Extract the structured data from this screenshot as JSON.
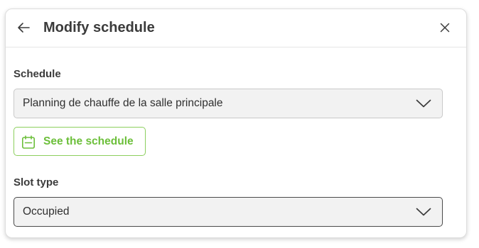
{
  "dialog": {
    "title": "Modify schedule"
  },
  "schedule": {
    "label": "Schedule",
    "selected": "Planning de chauffe de la salle principale"
  },
  "see_schedule": {
    "label": "See the schedule"
  },
  "slot_type": {
    "label": "Slot type",
    "selected": "Occupied"
  },
  "colors": {
    "accent_green": "#6cbf3a",
    "text_dark": "#3b3b3b",
    "field_bg": "#f2f2f2"
  },
  "icons": {
    "back": "arrow-left-icon",
    "close": "close-icon",
    "dropdown": "chevron-down-icon",
    "calendar": "calendar-icon"
  }
}
